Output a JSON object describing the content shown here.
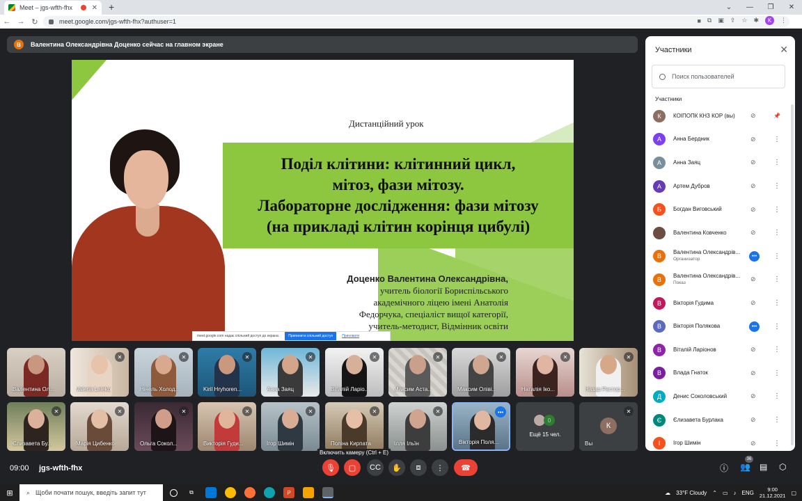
{
  "browser": {
    "tab_title": "Meet – jgs-wfth-fhx",
    "url": "meet.google.com/jgs-wfth-fhx?authuser=1",
    "profile_initial": "K"
  },
  "banner": {
    "avatar": "В",
    "text": "Валентина Олександрівна Доценко сейчас на главном экране"
  },
  "slide": {
    "subtitle": "Дистанційний урок",
    "title_lines": [
      "Поділ клітини: клітинний цикл,",
      "мітоз, фази мітозу.",
      "Лабораторне дослідження: фази мітозу",
      "(на прикладі клітин корінця цибулі)"
    ],
    "author_name": "Доценко Валентина Олександрівна,",
    "author_lines": [
      "учитель біології Бориспільського",
      "академічного ліцею імені Анатолія",
      "Федорчука, спеціаліст вищої категорії,",
      "учитель-методист, Відмінник освіти"
    ],
    "share_text": "meet.google.com надає спільний доступ до екрана.",
    "share_stop": "Припинити спільний доступ",
    "share_hide": "Приховати"
  },
  "tiles": [
    {
      "name": "Валентина Ол..."
    },
    {
      "name": "Valeria Leleko"
    },
    {
      "name": "Нінель Холод..."
    },
    {
      "name": "Kiril Hryhoren..."
    },
    {
      "name": "Анна Заяц"
    },
    {
      "name": "Віталій Ларіо..."
    },
    {
      "name": "Максим Аста..."
    },
    {
      "name": "Максим Оліві..."
    },
    {
      "name": "Наталія Іко..."
    },
    {
      "name": "Назар Растор..."
    },
    {
      "name": "Єлизавета Бу..."
    },
    {
      "name": "Марія Цибенко"
    },
    {
      "name": "Ольга Сокол..."
    },
    {
      "name": "Викторія Гуди..."
    },
    {
      "name": "Ігор Шимін"
    },
    {
      "name": "Поліна Кирпата"
    },
    {
      "name": "Ілля Ільїн"
    },
    {
      "name": "Вікторія Поля..."
    }
  ],
  "more_tile": {
    "label": "Ещё 15 чел.",
    "count_badge": "0"
  },
  "you_tile": {
    "label": "Вы",
    "initial": "К"
  },
  "controls": {
    "time": "09:00",
    "meeting_code": "jgs-wfth-fhx",
    "tooltip": "Включить камеру (Ctrl + E)",
    "participants_badge": "36"
  },
  "panel": {
    "title": "Участники",
    "search_placeholder": "Поиск пользователей",
    "section": "Участники",
    "participants": [
      {
        "initial": "К",
        "name": "КОІПОПК КНЗ КОР (вы)",
        "sub": "",
        "color": "#8d6e63"
      },
      {
        "initial": "А",
        "name": "Анна Бердник",
        "sub": "",
        "color": "#7e3ff2"
      },
      {
        "initial": "А",
        "name": "Анна Заяц",
        "sub": "",
        "color": "#78909c"
      },
      {
        "initial": "А",
        "name": "Артем Дубров",
        "sub": "",
        "color": "#673ab7"
      },
      {
        "initial": "Б",
        "name": "Богдан Виговський",
        "sub": "",
        "color": "#f4511e"
      },
      {
        "initial": "",
        "name": "Валентина Ковченко",
        "sub": "",
        "color": "#6d4c41"
      },
      {
        "initial": "В",
        "name": "Валентина Олександрів...",
        "sub": "Организатор",
        "color": "#e8710a"
      },
      {
        "initial": "В",
        "name": "Валентина Олександрів...",
        "sub": "Показ",
        "color": "#e8710a"
      },
      {
        "initial": "В",
        "name": "Вікторія Гудима",
        "sub": "",
        "color": "#c2185b"
      },
      {
        "initial": "В",
        "name": "Вікторія Полякова",
        "sub": "",
        "color": "#5c6bc0"
      },
      {
        "initial": "В",
        "name": "Віталій Ларіонов",
        "sub": "",
        "color": "#8e24aa"
      },
      {
        "initial": "В",
        "name": "Влада Гнаток",
        "sub": "",
        "color": "#7b1fa2"
      },
      {
        "initial": "Д",
        "name": "Денис Соколовський",
        "sub": "",
        "color": "#00acc1"
      },
      {
        "initial": "Є",
        "name": "Єлизавета Бурлака",
        "sub": "",
        "color": "#00897b"
      },
      {
        "initial": "І",
        "name": "Ігор Шимін",
        "sub": "",
        "color": "#f4511e"
      }
    ]
  },
  "taskbar": {
    "search_placeholder": "Щоби почати пошук, введіть запит тут",
    "weather": "33°F  Cloudy",
    "lang": "ENG",
    "time": "9:00",
    "date": "21.12.2021"
  }
}
